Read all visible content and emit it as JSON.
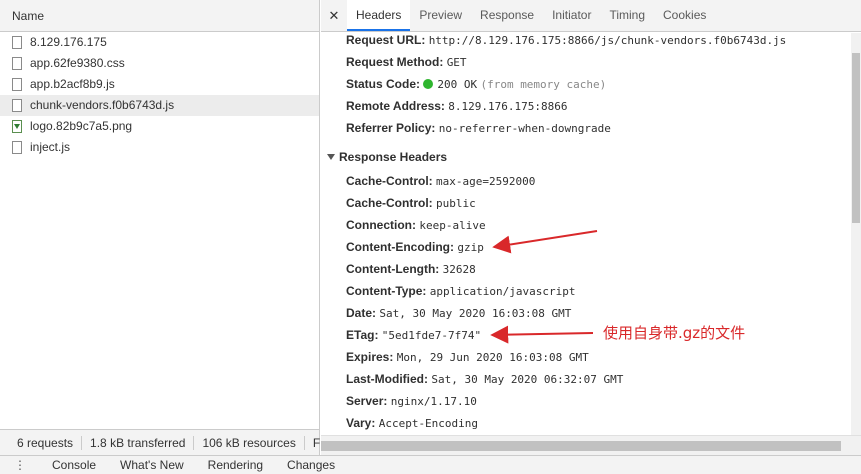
{
  "left_pane": {
    "column_header": "Name",
    "files": [
      {
        "name": "8.129.176.175",
        "icon": "document-icon"
      },
      {
        "name": "app.62fe9380.css",
        "icon": "document-icon"
      },
      {
        "name": "app.b2acf8b9.js",
        "icon": "document-icon"
      },
      {
        "name": "chunk-vendors.f0b6743d.js",
        "icon": "document-icon",
        "selected": true
      },
      {
        "name": "logo.82b9c7a5.png",
        "icon": "image-icon"
      },
      {
        "name": "inject.js",
        "icon": "document-icon"
      }
    ],
    "summary": {
      "requests": "6 requests",
      "transferred": "1.8 kB transferred",
      "resources": "106 kB resources",
      "more": "F"
    }
  },
  "right_pane": {
    "close_glyph": "✕",
    "tabs": [
      "Headers",
      "Preview",
      "Response",
      "Initiator",
      "Timing",
      "Cookies"
    ],
    "active_tab": "Headers",
    "general": {
      "request_url": {
        "key": "Request URL:",
        "value": "http://8.129.176.175:8866/js/chunk-vendors.f0b6743d.js"
      },
      "request_method": {
        "key": "Request Method:",
        "value": "GET"
      },
      "status_code": {
        "key": "Status Code:",
        "value": "200 OK",
        "note": "(from memory cache)",
        "dot_color": "#2fb52f"
      },
      "remote_address": {
        "key": "Remote Address:",
        "value": "8.129.176.175:8866"
      },
      "referrer_policy": {
        "key": "Referrer Policy:",
        "value": "no-referrer-when-downgrade"
      }
    },
    "response_headers_title": "Response Headers",
    "response_headers": [
      {
        "key": "Cache-Control:",
        "value": "max-age=2592000"
      },
      {
        "key": "Cache-Control:",
        "value": "public"
      },
      {
        "key": "Connection:",
        "value": "keep-alive"
      },
      {
        "key": "Content-Encoding:",
        "value": "gzip"
      },
      {
        "key": "Content-Length:",
        "value": "32628"
      },
      {
        "key": "Content-Type:",
        "value": "application/javascript"
      },
      {
        "key": "Date:",
        "value": "Sat, 30 May 2020 16:03:08 GMT"
      },
      {
        "key": "ETag:",
        "value": "\"5ed1fde7-7f74\""
      },
      {
        "key": "Expires:",
        "value": "Mon, 29 Jun 2020 16:03:08 GMT"
      },
      {
        "key": "Last-Modified:",
        "value": "Sat, 30 May 2020 06:32:07 GMT"
      },
      {
        "key": "Server:",
        "value": "nginx/1.17.10"
      },
      {
        "key": "Vary:",
        "value": "Accept-Encoding"
      }
    ]
  },
  "drawer": {
    "menu_glyph": "⋮",
    "tabs": [
      "Console",
      "What's New",
      "Rendering",
      "Changes"
    ]
  },
  "annotation": {
    "text": "使用自身带.gz的文件",
    "color": "#d9282a"
  }
}
